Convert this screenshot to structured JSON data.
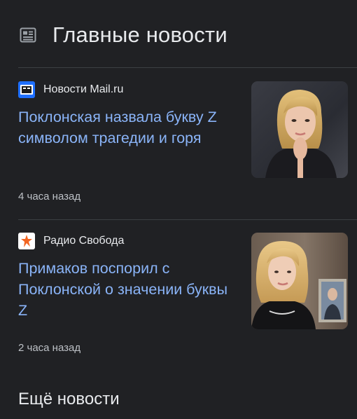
{
  "header": {
    "title": "Главные новости",
    "icon": "newspaper-icon"
  },
  "articles": [
    {
      "source": "Новости Mail.ru",
      "favicon": "mailru-news-icon",
      "headline": "Поклонская назвала букву Z символом трагедии и горя",
      "time": "4 часа назад",
      "thumbnail": "woman-portrait-thumbnail"
    },
    {
      "source": "Радио Свобода",
      "favicon": "radio-svoboda-icon",
      "headline": "Примаков поспорил с Поклонской о значении буквы Z",
      "time": "2 часа назад",
      "thumbnail": "woman-with-portrait-background-thumbnail"
    }
  ],
  "more_news": "Ещё новости",
  "colors": {
    "background": "#202124",
    "headline": "#8ab4f8",
    "text": "#e8eaed",
    "muted": "#bdc1c6",
    "divider": "#3c4043"
  }
}
